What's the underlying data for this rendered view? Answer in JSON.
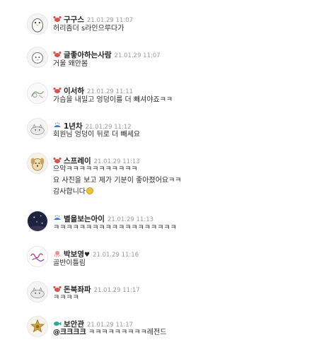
{
  "colors": {
    "nickname": "#222222",
    "timestamp": "#9a9a9a",
    "body_text": "#2b2b2b",
    "crab_level_icon": "#d9534f",
    "whale_level_icon": "#3a7bd5",
    "octopus_level_icon": "#e88f8f",
    "fish_level_icon": "#35a89a"
  },
  "comments": [
    {
      "nickname": "구구스",
      "time": "21.01.29 11:07",
      "level_icon": "crab-icon",
      "avatar": "penguin-avatar",
      "lines": [
        "허리좀더 s라인으루다가"
      ]
    },
    {
      "nickname": "글좋아하는사람",
      "time": "21.01.29 11:07",
      "level_icon": "crab-icon",
      "avatar": "sheep-avatar",
      "lines": [
        "거울 왜안봄"
      ]
    },
    {
      "nickname": "이서하",
      "time": "21.01.29 11:11",
      "level_icon": "crab-icon",
      "avatar": "drawing-avatar",
      "lines": [
        "가슴을 내밀고 엉덩이를 더 빼셔야죠ㅋㅋ"
      ]
    },
    {
      "nickname": "1년차",
      "time": "21.01.29 11:12",
      "level_icon": "whale-icon",
      "avatar": "cat-avatar",
      "lines": [
        "회원님 엉덩이 뒤로 더 빼세요"
      ]
    },
    {
      "nickname": "스프레이",
      "time": "21.01.29 11:13",
      "level_icon": "crab-icon",
      "avatar": "dog-avatar",
      "lines": [
        "으악ㅋㅋㅋㅋㅋㅋㅋㅋㅋㅋㅋ",
        "요 사진을 보고 제가 기분이 좋아졌어요ㅋㅋ",
        "감사합니다"
      ],
      "emoji_after_last_line": "smile-emoji"
    },
    {
      "nickname": "별을보는아이",
      "time": "21.01.29 11:13",
      "level_icon": "whale-icon",
      "avatar": "night-sky-avatar",
      "lines": [
        "ㅋㅋㅋㅋㅋㅋㅋㅋㅋㅋㅋㅋㅋㅋㅋㅋㅋㅋㅋ"
      ]
    },
    {
      "nickname": "박보영",
      "heart": "♥",
      "time": "21.01.29 11:16",
      "level_icon": "octopus-icon",
      "avatar": "handwriting-avatar",
      "lines": [
        "골반이틀림"
      ]
    },
    {
      "nickname": "돈북좌파",
      "time": "21.01.29 11:17",
      "level_icon": "crab-icon",
      "avatar": "cat-avatar",
      "lines": [
        "ㅋㅋㅋㅋ"
      ]
    },
    {
      "nickname": "보안관",
      "time": "21.01.29 11:17",
      "level_icon": "fish-icon",
      "avatar": "sheriff-badge-avatar",
      "mention": "@크크크크",
      "lines": [
        "ㅋㅋㅋㅋㅋㅋㅋㅋㅋ레전드"
      ]
    }
  ]
}
